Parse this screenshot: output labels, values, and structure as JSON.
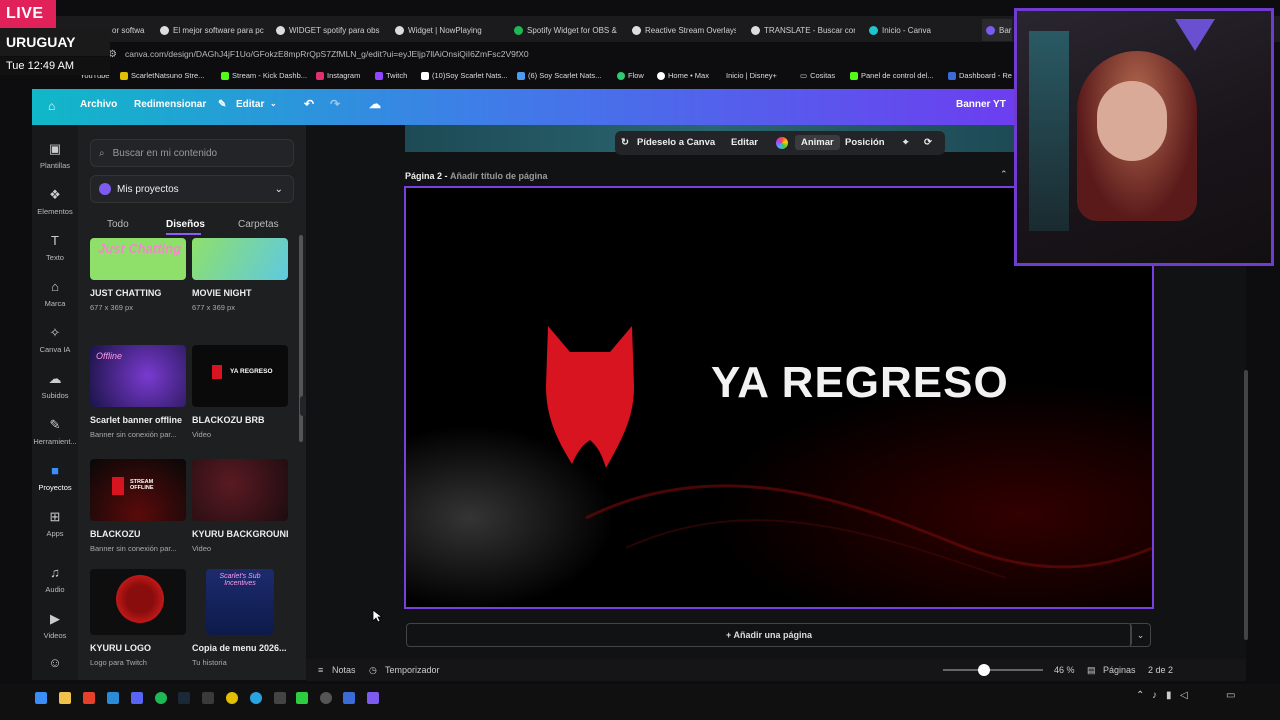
{
  "overlay": {
    "live": "LIVE",
    "country": "URUGUAY",
    "clock": "Tue 12:49 AM"
  },
  "browser": {
    "tabs": [
      {
        "label": "or softwa"
      },
      {
        "label": "El mejor software para pc"
      },
      {
        "label": "WIDGET spotify para obs"
      },
      {
        "label": "Widget | NowPlaying"
      },
      {
        "label": "Spotify Widget for OBS &"
      },
      {
        "label": "Reactive Stream Overlays"
      },
      {
        "label": "TRANSLATE - Buscar con"
      },
      {
        "label": "Inicio - Canva"
      },
      {
        "label": "Bar"
      }
    ],
    "url": "canva.com/design/DAGhJ4jF1Uo/GFokzE8mpRrQpS7ZfMLN_g/edit?ui=eyJEljp7llAiOnsiQiI6ZmFsc2V9fX0",
    "bookmarks": [
      {
        "label": "YouTube"
      },
      {
        "label": "ScarletNatsuno Stre..."
      },
      {
        "label": "Stream - Kick Dashb..."
      },
      {
        "label": "Instagram"
      },
      {
        "label": "Twitch"
      },
      {
        "label": "(10)Soy Scarlet Nats..."
      },
      {
        "label": "(6) Soy Scarlet Nats..."
      },
      {
        "label": "Flow"
      },
      {
        "label": "Home • Max"
      },
      {
        "label": "Inicio | Disney+"
      },
      {
        "label": "Cositas"
      },
      {
        "label": "Panel de control del..."
      },
      {
        "label": "Dashboard - Re"
      }
    ]
  },
  "header": {
    "archivo": "Archivo",
    "redimensionar": "Redimensionar",
    "editar": "Editar",
    "title": "Banner YT"
  },
  "sidebar": {
    "items": [
      {
        "label": "Plantillas",
        "icon": "template-icon"
      },
      {
        "label": "Elementos",
        "icon": "shapes-icon"
      },
      {
        "label": "Texto",
        "icon": "text-icon"
      },
      {
        "label": "Marca",
        "icon": "brand-icon"
      },
      {
        "label": "Canva IA",
        "icon": "ai-icon"
      },
      {
        "label": "Subidos",
        "icon": "cloud-icon"
      },
      {
        "label": "Herramient...",
        "icon": "draw-icon"
      },
      {
        "label": "Proyectos",
        "icon": "folder-icon"
      },
      {
        "label": "Apps",
        "icon": "apps-icon"
      },
      {
        "label": "Audio",
        "icon": "music-icon"
      },
      {
        "label": "Videos",
        "icon": "video-icon"
      }
    ]
  },
  "panel": {
    "search_placeholder": "Buscar en mi contenido",
    "projects": "Mis proyectos",
    "tabs": [
      "Todo",
      "Diseños",
      "Carpetas"
    ],
    "cards": [
      {
        "title": "JUST CHATTING",
        "sub": "677 x 369 px",
        "thumb": "Just Chatting"
      },
      {
        "title": "MOVIE NIGHT",
        "sub": "677 x 369 px",
        "thumb": ""
      },
      {
        "title": "Scarlet banner offline",
        "sub": "Banner sin conexión par...",
        "thumb": "Offline"
      },
      {
        "title": "BLACKOZU BRB",
        "sub": "Video",
        "thumb": "YA REGRESO"
      },
      {
        "title": "BLACKOZU",
        "sub": "Banner sin conexión par...",
        "thumb": "STREAM OFFLINE"
      },
      {
        "title": "KYURU BACKGROUND",
        "sub": "Video",
        "thumb": ""
      },
      {
        "title": "KYURU LOGO",
        "sub": "Logo para Twitch",
        "thumb": ""
      },
      {
        "title": "Copia de menu 2026...",
        "sub": "Tu historia",
        "thumb": "Scarlet's Sub Incentives"
      }
    ]
  },
  "toolbar": {
    "pideselo": "Pídeselo a Canva",
    "editar": "Editar",
    "animar": "Animar",
    "posicion": "Posición"
  },
  "page": {
    "label": "Página 2 -",
    "add_title": "Añadir título de página",
    "design_text": "YA REGRESO"
  },
  "add_page": "+ Añadir una página",
  "bottom": {
    "notas": "Notas",
    "temporizador": "Temporizador",
    "zoom": "46 %",
    "zoom_fraction": 0.41,
    "paginas": "Páginas",
    "page_count": "2 de 2"
  },
  "colors": {
    "accent": "#7a3fe0",
    "brand_red": "#d7141f"
  }
}
